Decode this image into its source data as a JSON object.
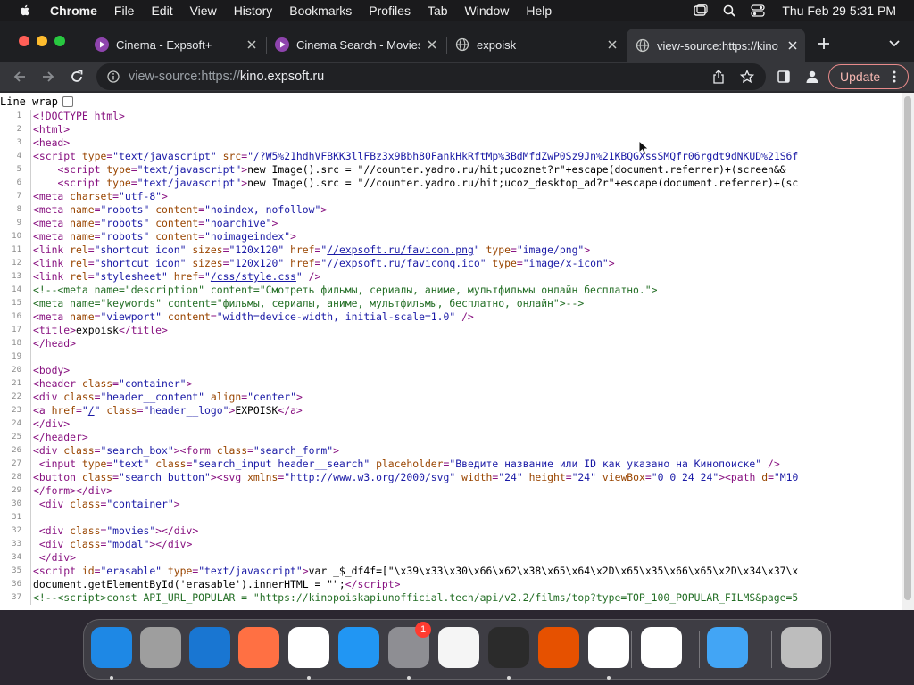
{
  "menubar": {
    "app": "Chrome",
    "menus": [
      "File",
      "Edit",
      "View",
      "History",
      "Bookmarks",
      "Profiles",
      "Tab",
      "Window",
      "Help"
    ],
    "clock": "Thu Feb 29  5:31 PM",
    "icons": [
      "window-icon",
      "search-icon",
      "control-center-icon"
    ]
  },
  "tabs": [
    {
      "title": "Cinema - Expsoft+",
      "icon": "play-icon"
    },
    {
      "title": "Cinema Search - Movies",
      "icon": "play-icon"
    },
    {
      "title": "expoisk",
      "icon": "globe-icon"
    },
    {
      "title": "view-source:https://kino",
      "icon": "globe-icon"
    }
  ],
  "toolbar": {
    "url_scheme": "view-source:https://",
    "url_host": "kino.expsoft.ru",
    "update_label": "Update"
  },
  "page": {
    "line_wrap_label": "Line wrap",
    "lines": [
      {
        "n": "1",
        "html": "<span class='tag'>&lt;!DOCTYPE html&gt;</span>"
      },
      {
        "n": "2",
        "html": "<span class='tag'>&lt;html&gt;</span>"
      },
      {
        "n": "3",
        "html": "<span class='tag'>&lt;head&gt;</span>"
      },
      {
        "n": "4",
        "html": "<span class='tag'>&lt;script </span><span class='attr'>type</span><span class='tag'>=</span><span class='val'>\"text/javascript\"</span> <span class='attr'>src</span><span class='tag'>=</span><span class='val'>\"</span><span class='lnk'>/?W5%21hdhVFBKK3llFBz3x9Bbh80FankHkRftMp%3BdMfdZwP0Sz9Jn%21KBQGXssSMQfr06rgdt9dNKUD%21S6f</span>"
      },
      {
        "n": "5",
        "html": "    <span class='tag'>&lt;script </span><span class='attr'>type</span><span class='tag'>=</span><span class='val'>\"text/javascript\"</span><span class='tag'>&gt;</span><span class='txt'>new Image().src = \"//counter.yadro.ru/hit;ucoznet?r\"+escape(document.referrer)+(screen&amp;&amp;</span>"
      },
      {
        "n": "6",
        "html": "    <span class='tag'>&lt;script </span><span class='attr'>type</span><span class='tag'>=</span><span class='val'>\"text/javascript\"</span><span class='tag'>&gt;</span><span class='txt'>new Image().src = \"//counter.yadro.ru/hit;ucoz_desktop_ad?r\"+escape(document.referrer)+(sc</span>"
      },
      {
        "n": "7",
        "html": "<span class='tag'>&lt;meta </span><span class='attr'>charset</span><span class='tag'>=</span><span class='val'>\"utf-8\"</span><span class='tag'>&gt;</span>"
      },
      {
        "n": "8",
        "html": "<span class='tag'>&lt;meta </span><span class='attr'>name</span><span class='tag'>=</span><span class='val'>\"robots\"</span> <span class='attr'>content</span><span class='tag'>=</span><span class='val'>\"noindex, nofollow\"</span><span class='tag'>&gt;</span>"
      },
      {
        "n": "9",
        "html": "<span class='tag'>&lt;meta </span><span class='attr'>name</span><span class='tag'>=</span><span class='val'>\"robots\"</span> <span class='attr'>content</span><span class='tag'>=</span><span class='val'>\"noarchive\"</span><span class='tag'>&gt;</span>"
      },
      {
        "n": "10",
        "html": "<span class='tag'>&lt;meta </span><span class='attr'>name</span><span class='tag'>=</span><span class='val'>\"robots\"</span> <span class='attr'>content</span><span class='tag'>=</span><span class='val'>\"noimageindex\"</span><span class='tag'>&gt;</span>"
      },
      {
        "n": "11",
        "html": "<span class='tag'>&lt;link </span><span class='attr'>rel</span><span class='tag'>=</span><span class='val'>\"shortcut icon\"</span> <span class='attr'>sizes</span><span class='tag'>=</span><span class='val'>\"120x120\"</span> <span class='attr'>href</span><span class='tag'>=</span><span class='val'>\"</span><span class='lnk'>//expsoft.ru/favicon.png</span><span class='val'>\"</span> <span class='attr'>type</span><span class='tag'>=</span><span class='val'>\"image/png\"</span><span class='tag'>&gt;</span>"
      },
      {
        "n": "12",
        "html": "<span class='tag'>&lt;link </span><span class='attr'>rel</span><span class='tag'>=</span><span class='val'>\"shortcut icon\"</span> <span class='attr'>sizes</span><span class='tag'>=</span><span class='val'>\"120x120\"</span> <span class='attr'>href</span><span class='tag'>=</span><span class='val'>\"</span><span class='lnk'>//expsoft.ru/faviconq.ico</span><span class='val'>\"</span> <span class='attr'>type</span><span class='tag'>=</span><span class='val'>\"image/x-icon\"</span><span class='tag'>&gt;</span>"
      },
      {
        "n": "13",
        "html": "<span class='tag'>&lt;link </span><span class='attr'>rel</span><span class='tag'>=</span><span class='val'>\"stylesheet\"</span> <span class='attr'>href</span><span class='tag'>=</span><span class='val'>\"</span><span class='lnk'>/css/style.css</span><span class='val'>\"</span> <span class='tag'>/&gt;</span>"
      },
      {
        "n": "14",
        "html": "<span class='cmt'>&lt;!--&lt;meta name=\"description\" content=\"Смотреть фильмы, сериалы, аниме, мультфильмы онлайн бесплатно.\"&gt;</span>"
      },
      {
        "n": "15",
        "html": "<span class='cmt'>&lt;meta name=\"keywords\" content=\"фильмы, сериалы, аниме, мультфильмы, бесплатно, онлайн\"&gt;--&gt;</span>"
      },
      {
        "n": "16",
        "html": "<span class='tag'>&lt;meta </span><span class='attr'>name</span><span class='tag'>=</span><span class='val'>\"viewport\"</span> <span class='attr'>content</span><span class='tag'>=</span><span class='val'>\"width=device-width, initial-scale=1.0\"</span> <span class='tag'>/&gt;</span>"
      },
      {
        "n": "17",
        "html": "<span class='tag'>&lt;title&gt;</span><span class='txt'>expoisk</span><span class='tag'>&lt;/title&gt;</span>"
      },
      {
        "n": "18",
        "html": "<span class='tag'>&lt;/head&gt;</span>"
      },
      {
        "n": "19",
        "html": ""
      },
      {
        "n": "20",
        "html": "<span class='tag'>&lt;body&gt;</span>"
      },
      {
        "n": "21",
        "html": "<span class='tag'>&lt;header </span><span class='attr'>class</span><span class='tag'>=</span><span class='val'>\"container\"</span><span class='tag'>&gt;</span>"
      },
      {
        "n": "22",
        "html": "<span class='tag'>&lt;div </span><span class='attr'>class</span><span class='tag'>=</span><span class='val'>\"header__content\"</span> <span class='attr'>align</span><span class='tag'>=</span><span class='val'>\"center\"</span><span class='tag'>&gt;</span>"
      },
      {
        "n": "23",
        "html": "<span class='tag'>&lt;a </span><span class='attr'>href</span><span class='tag'>=</span><span class='val'>\"</span><span class='lnk'>/</span><span class='val'>\"</span> <span class='attr'>class</span><span class='tag'>=</span><span class='val'>\"header__logo\"</span><span class='tag'>&gt;</span><span class='txt'>EXPOISK</span><span class='tag'>&lt;/a&gt;</span>"
      },
      {
        "n": "24",
        "html": "<span class='tag'>&lt;/div&gt;</span>"
      },
      {
        "n": "25",
        "html": "<span class='tag'>&lt;/header&gt;</span>"
      },
      {
        "n": "26",
        "html": "<span class='tag'>&lt;div </span><span class='attr'>class</span><span class='tag'>=</span><span class='val'>\"search_box\"</span><span class='tag'>&gt;&lt;form </span><span class='attr'>class</span><span class='tag'>=</span><span class='val'>\"search_form\"</span><span class='tag'>&gt;</span>"
      },
      {
        "n": "27",
        "html": " <span class='tag'>&lt;input </span><span class='attr'>type</span><span class='tag'>=</span><span class='val'>\"text\"</span> <span class='attr'>class</span><span class='tag'>=</span><span class='val'>\"search_input header__search\"</span> <span class='attr'>placeholder</span><span class='tag'>=</span><span class='val'>\"Введите название или ID как указано на Кинопоиске\"</span> <span class='tag'>/&gt;</span>"
      },
      {
        "n": "28",
        "html": "<span class='tag'>&lt;button </span><span class='attr'>class</span><span class='tag'>=</span><span class='val'>\"search_button\"</span><span class='tag'>&gt;&lt;svg </span><span class='attr'>xmlns</span><span class='tag'>=</span><span class='val'>\"http://www.w3.org/2000/svg\"</span> <span class='attr'>width</span><span class='tag'>=</span><span class='val'>\"24\"</span> <span class='attr'>height</span><span class='tag'>=</span><span class='val'>\"24\"</span> <span class='attr'>viewBox</span><span class='tag'>=</span><span class='val'>\"0 0 24 24\"</span><span class='tag'>&gt;&lt;path </span><span class='attr'>d</span><span class='tag'>=</span><span class='val'>\"M10</span>"
      },
      {
        "n": "29",
        "html": "<span class='tag'>&lt;/form&gt;&lt;/div&gt;</span>"
      },
      {
        "n": "30",
        "html": " <span class='tag'>&lt;div </span><span class='attr'>class</span><span class='tag'>=</span><span class='val'>\"container\"</span><span class='tag'>&gt;</span>"
      },
      {
        "n": "31",
        "html": ""
      },
      {
        "n": "32",
        "html": " <span class='tag'>&lt;div </span><span class='attr'>class</span><span class='tag'>=</span><span class='val'>\"movies\"</span><span class='tag'>&gt;&lt;/div&gt;</span>"
      },
      {
        "n": "33",
        "html": " <span class='tag'>&lt;div </span><span class='attr'>class</span><span class='tag'>=</span><span class='val'>\"modal\"</span><span class='tag'>&gt;&lt;/div&gt;</span>"
      },
      {
        "n": "34",
        "html": " <span class='tag'>&lt;/div&gt;</span>"
      },
      {
        "n": "35",
        "html": "<span class='tag'>&lt;script </span><span class='attr'>id</span><span class='tag'>=</span><span class='val'>\"erasable\"</span> <span class='attr'>type</span><span class='tag'>=</span><span class='val'>\"text/javascript\"</span><span class='tag'>&gt;</span><span class='txt'>var _$_df4f=[\"\\x39\\x33\\x30\\x66\\x62\\x38\\x65\\x64\\x2D\\x65\\x35\\x66\\x65\\x2D\\x34\\x37\\x</span>"
      },
      {
        "n": "36",
        "html": "<span class='txt'>document.getElementById('erasable').innerHTML = \"\";</span><span class='tag'>&lt;/script&gt;</span>"
      },
      {
        "n": "37",
        "html": "<span class='cmt'>&lt;!--&lt;script&gt;const API_URL_POPULAR = \"https://kinopoiskapiunofficial.tech/api/v2.2/films/top?type=TOP_100_POPULAR_FILMS&amp;page=5</span>"
      }
    ]
  },
  "dock": {
    "apps": [
      {
        "name": "finder-icon",
        "color": "#1e88e5",
        "running": true
      },
      {
        "name": "launchpad-icon",
        "color": "#9e9e9e",
        "running": false
      },
      {
        "name": "safari-icon",
        "color": "#1976d2",
        "running": false
      },
      {
        "name": "firefox-icon",
        "color": "#ff7043",
        "running": false
      },
      {
        "name": "chrome-icon",
        "color": "#ffffff",
        "running": true
      },
      {
        "name": "app-store-icon",
        "color": "#2196f3",
        "running": false
      },
      {
        "name": "system-settings-icon",
        "color": "#8e8e93",
        "running": true,
        "badge": "1"
      },
      {
        "name": "textedit-icon",
        "color": "#f5f5f5",
        "running": false
      },
      {
        "name": "terminal-icon",
        "color": "#2b2b2b",
        "running": true
      },
      {
        "name": "garageband-icon",
        "color": "#e65100",
        "running": false
      },
      {
        "name": "vscode-icon",
        "color": "#ffffff",
        "running": true
      },
      {
        "name": "visual-studio-icon",
        "color": "#ffffff",
        "running": false
      },
      {
        "name": "weather-icon",
        "color": "#42a5f5",
        "running": false
      },
      {
        "name": "trash-icon",
        "color": "#bdbdbd",
        "running": false
      }
    ]
  },
  "colors": {
    "accent": "#e88a8a",
    "tab_strip": "#1e1f22",
    "toolbar": "#35363a"
  }
}
